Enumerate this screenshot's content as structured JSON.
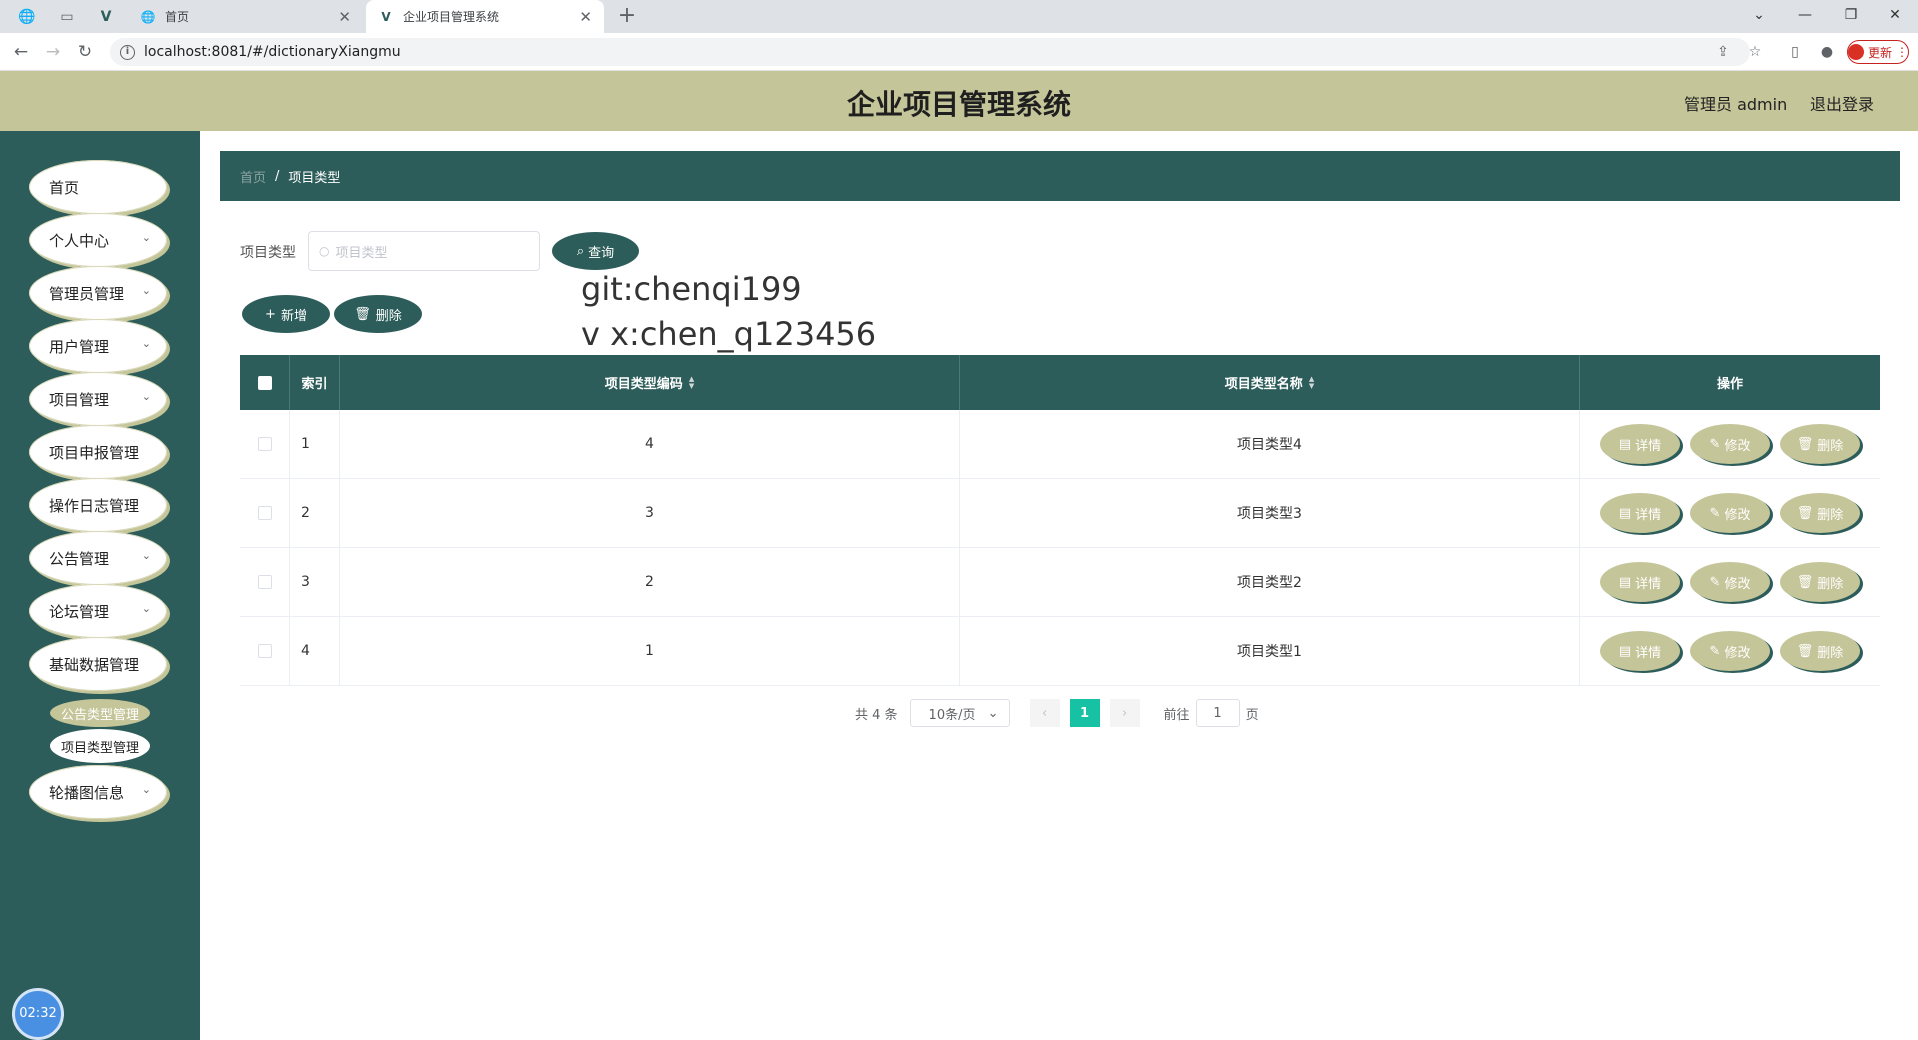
{
  "browser": {
    "tabs": [
      {
        "title": "首页",
        "active": false
      },
      {
        "title": "企业项目管理系统",
        "active": true
      }
    ],
    "url": "localhost:8081/#/dictionaryXiangmu",
    "update_label": "更新"
  },
  "header": {
    "title": "企业项目管理系统",
    "user": "管理员 admin",
    "logout": "退出登录"
  },
  "sidebar": {
    "items": [
      {
        "label": "首页",
        "has_children": false
      },
      {
        "label": "个人中心",
        "has_children": true
      },
      {
        "label": "管理员管理",
        "has_children": true
      },
      {
        "label": "用户管理",
        "has_children": true
      },
      {
        "label": "项目管理",
        "has_children": true
      },
      {
        "label": "项目申报管理",
        "has_children": false
      },
      {
        "label": "操作日志管理",
        "has_children": false
      },
      {
        "label": "公告管理",
        "has_children": true
      },
      {
        "label": "论坛管理",
        "has_children": true
      },
      {
        "label": "基础数据管理",
        "has_children": false
      },
      {
        "label": "轮播图信息",
        "has_children": true
      }
    ],
    "submenu": [
      {
        "label": "公告类型管理"
      },
      {
        "label": "项目类型管理"
      }
    ],
    "timer": "02:32"
  },
  "breadcrumb": {
    "home": "首页",
    "separator": "/",
    "current": "项目类型"
  },
  "search": {
    "label": "项目类型",
    "placeholder": "项目类型",
    "query_label": "查询"
  },
  "actions": {
    "add_label": "新增",
    "delete_label": "删除"
  },
  "watermark": {
    "line1": "git:chenqi199",
    "line2": "v x:chen_q123456"
  },
  "table": {
    "columns": {
      "index": "索引",
      "code": "项目类型编码",
      "name": "项目类型名称",
      "ops": "操作"
    },
    "rows": [
      {
        "index": "1",
        "code": "4",
        "name": "项目类型4"
      },
      {
        "index": "2",
        "code": "3",
        "name": "项目类型3"
      },
      {
        "index": "3",
        "code": "2",
        "name": "项目类型2"
      },
      {
        "index": "4",
        "code": "1",
        "name": "项目类型1"
      }
    ],
    "op_labels": {
      "detail": "详情",
      "edit": "修改",
      "delete": "删除"
    }
  },
  "pagination": {
    "total": "共 4 条",
    "page_size": "10条/页",
    "current_page": "1",
    "goto_label": "前往",
    "goto_value": "1",
    "page_suffix": "页"
  },
  "colors": {
    "primary": "#2d5d5a",
    "accent": "#c5c59a",
    "page_active": "#16c2a3"
  }
}
